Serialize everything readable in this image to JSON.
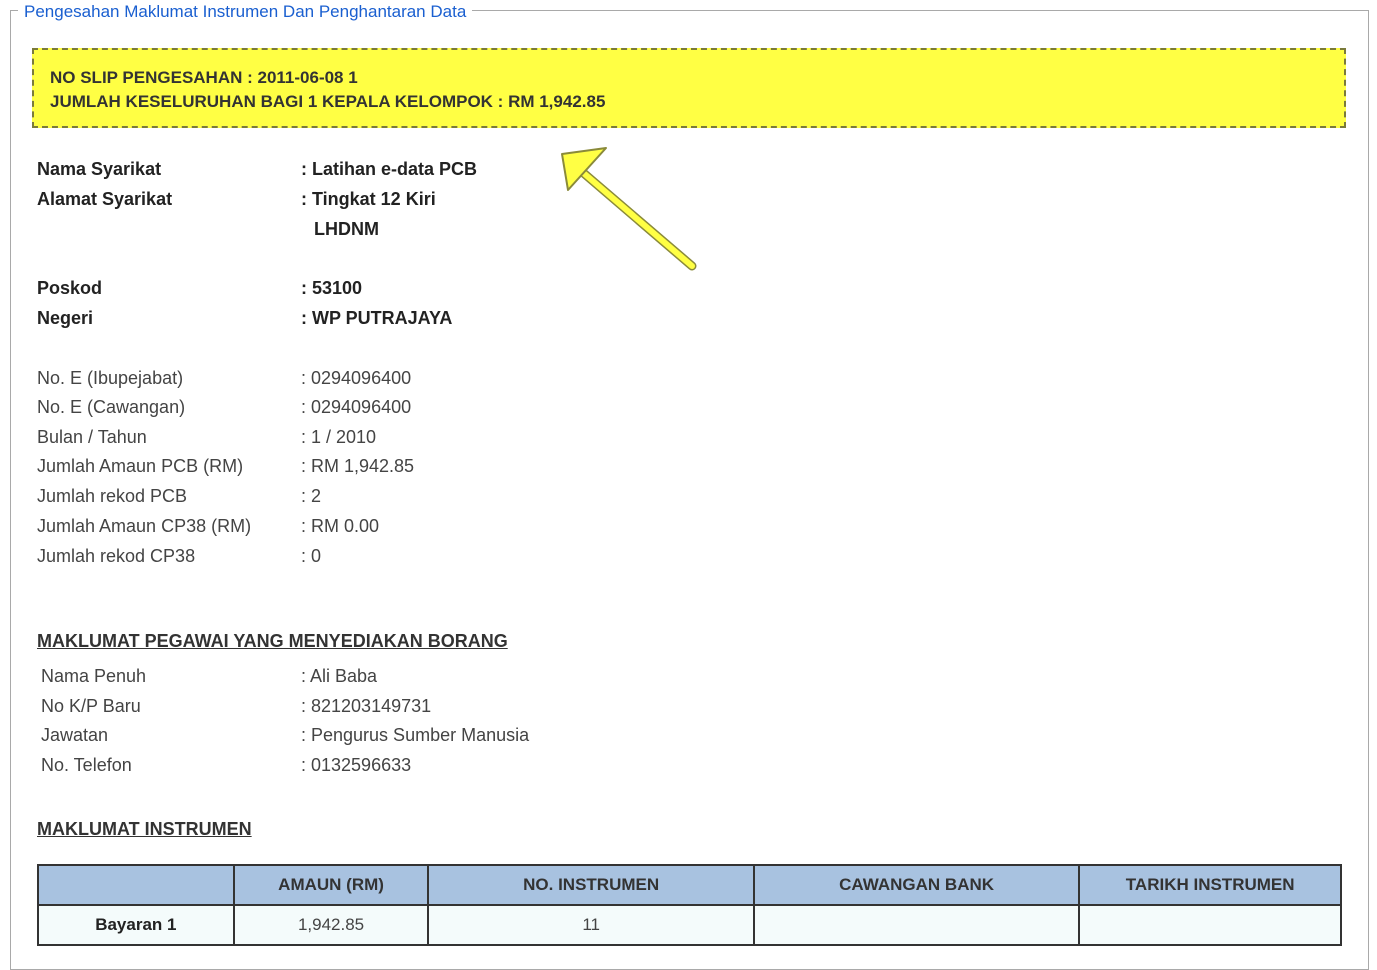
{
  "fieldset": {
    "legend": "Pengesahan Maklumat Instrumen Dan Penghantaran Data"
  },
  "notice": {
    "line1": "NO SLIP PENGESAHAN : 2011-06-08 1",
    "line2": "JUMLAH KESELURUHAN BAGI 1 KEPALA KELOMPOK : RM 1,942.85",
    "bg_color": "#ffff44"
  },
  "company": {
    "nama_label": "Nama Syarikat",
    "nama_value": ": Latihan e-data PCB",
    "alamat_label": "Alamat Syarikat",
    "alamat_line1": ": Tingkat 12 Kiri",
    "alamat_line2": "LHDNM",
    "poskod_label": "Poskod",
    "poskod_value": ": 53100",
    "negeri_label": "Negeri",
    "negeri_value": ": WP PUTRAJAYA"
  },
  "details": [
    {
      "label": "No. E (Ibupejabat)",
      "value": ": 0294096400"
    },
    {
      "label": "No. E (Cawangan)",
      "value": ": 0294096400"
    },
    {
      "label": "Bulan / Tahun",
      "value": ": 1 / 2010"
    },
    {
      "label": "Jumlah Amaun PCB (RM)",
      "value": ": RM 1,942.85"
    },
    {
      "label": "Jumlah rekod PCB",
      "value": ": 2"
    },
    {
      "label": "Jumlah Amaun CP38 (RM)",
      "value": ": RM 0.00"
    },
    {
      "label": "Jumlah rekod CP38",
      "value": ": 0"
    }
  ],
  "officer": {
    "title": "MAKLUMAT PEGAWAI YANG MENYEDIAKAN BORANG",
    "rows": [
      {
        "label": "Nama Penuh",
        "value": ": Ali Baba"
      },
      {
        "label": "No K/P Baru",
        "value": ": 821203149731"
      },
      {
        "label": "Jawatan",
        "value": ": Pengurus Sumber Manusia"
      },
      {
        "label": "No. Telefon",
        "value": ": 0132596633"
      }
    ]
  },
  "instrument": {
    "title": "MAKLUMAT INSTRUMEN",
    "headers": [
      "",
      "AMAUN (RM)",
      "NO. INSTRUMEN",
      "CAWANGAN BANK",
      "TARIKH INSTRUMEN"
    ],
    "rows": [
      [
        "Bayaran 1",
        "1,942.85",
        "11",
        "",
        ""
      ]
    ],
    "header_color": "#a8c2e0"
  },
  "annotation": {
    "arrow_color": "#ffff44",
    "arrow_icon": "arrow-up-left-icon"
  }
}
